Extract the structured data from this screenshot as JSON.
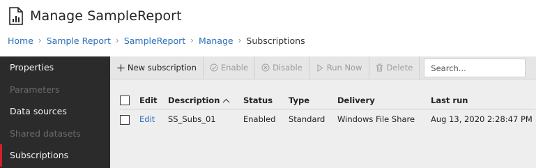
{
  "header": {
    "title": "Manage SampleReport",
    "icon": "report-icon"
  },
  "breadcrumb": {
    "items": [
      "Home",
      "Sample Report",
      "SampleReport",
      "Manage"
    ],
    "current": "Subscriptions"
  },
  "sidebar": {
    "items": [
      {
        "label": "Properties",
        "state": "enabled"
      },
      {
        "label": "Parameters",
        "state": "disabled"
      },
      {
        "label": "Data sources",
        "state": "enabled"
      },
      {
        "label": "Shared datasets",
        "state": "disabled"
      },
      {
        "label": "Subscriptions",
        "state": "active"
      }
    ]
  },
  "toolbar": {
    "new_label": "New subscription",
    "enable_label": "Enable",
    "disable_label": "Disable",
    "run_now_label": "Run Now",
    "delete_label": "Delete",
    "search_placeholder": "Search..."
  },
  "table": {
    "columns": [
      "Edit",
      "Description",
      "Status",
      "Type",
      "Delivery",
      "Last run"
    ],
    "rows": [
      {
        "edit": "Edit",
        "description": "SS_Subs_01",
        "status": "Enabled",
        "type": "Standard",
        "delivery": "Windows File Share",
        "last_run": "Aug 13, 2020 2:28:47 PM"
      }
    ]
  },
  "colors": {
    "link": "#2a6ebb",
    "sidebar_bg": "#2b2b2b",
    "active_marker": "#d0212c",
    "content_bg": "#eeeeee"
  }
}
